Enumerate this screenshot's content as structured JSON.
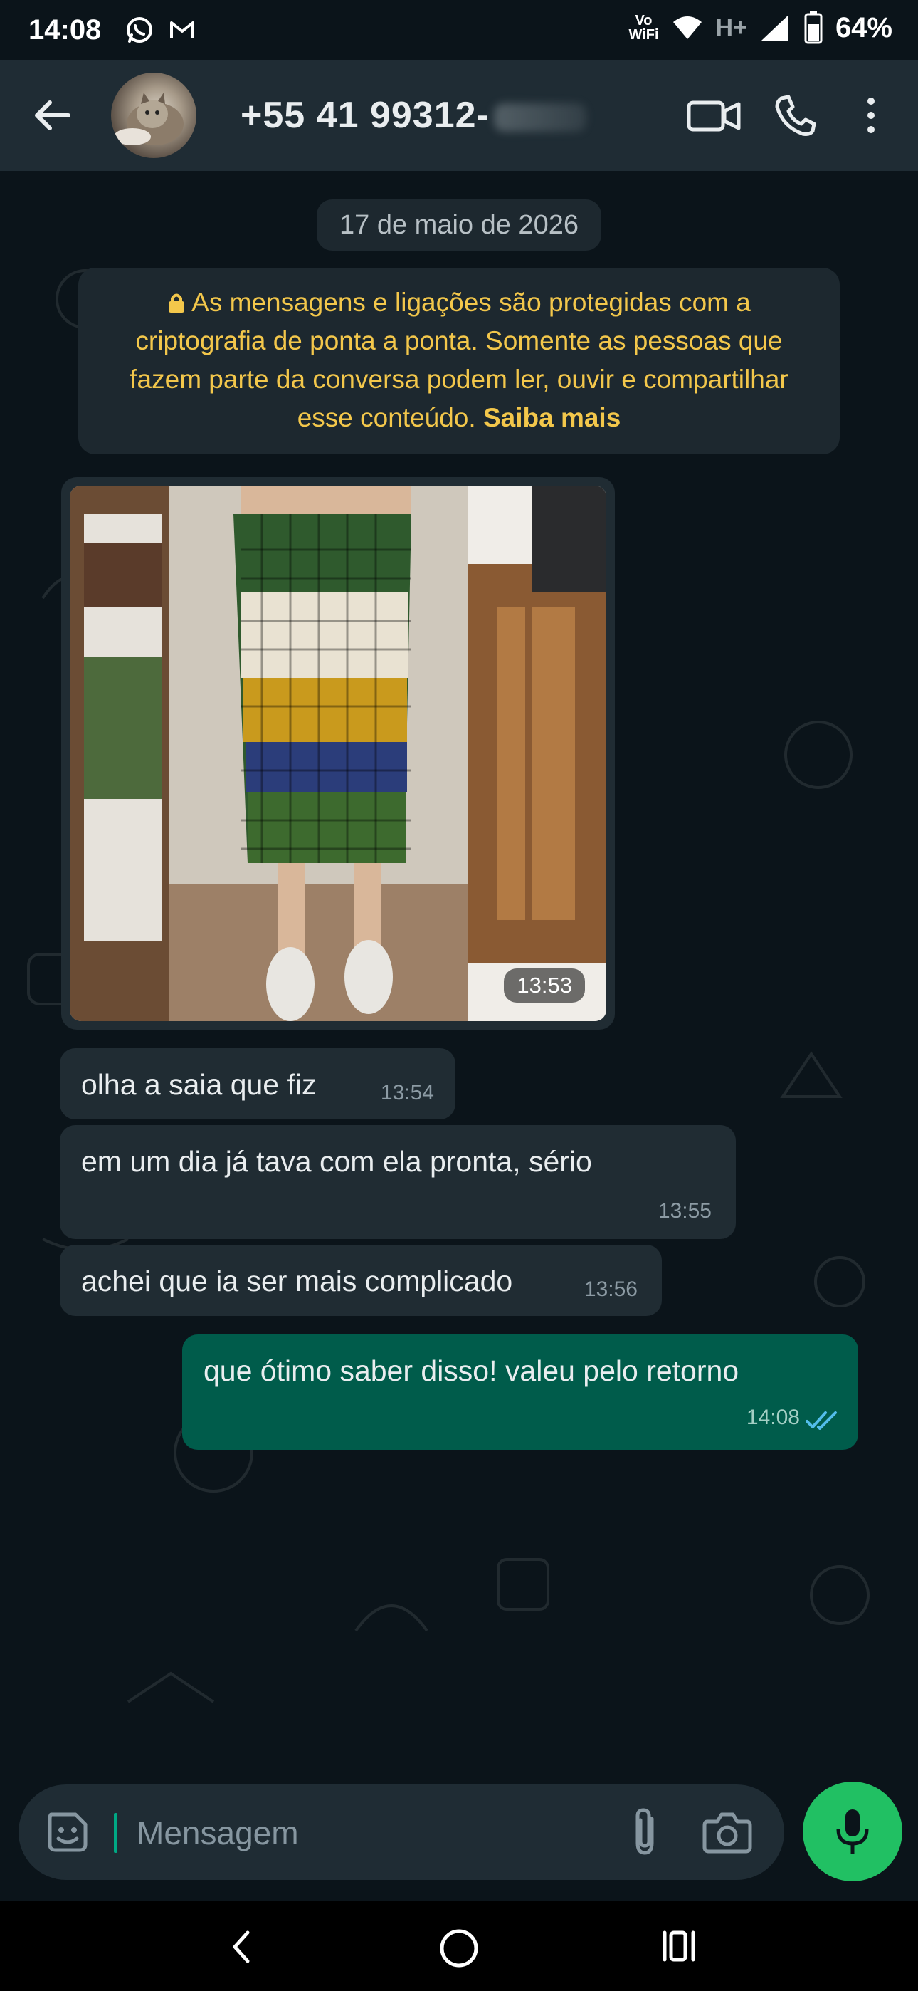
{
  "status_bar": {
    "time": "14:08",
    "volte_top": "Vo",
    "volte_bottom": "WiFi",
    "network": "H+",
    "battery": "64%",
    "app_icons": [
      "whatsapp-icon",
      "gmail-icon"
    ]
  },
  "header": {
    "contact_name": "+55 41 99312-",
    "icons": [
      "back-arrow-icon",
      "video-call-icon",
      "phone-icon",
      "more-vert-icon"
    ]
  },
  "chat": {
    "date_chip": "17 de maio de 2026",
    "e2e_notice": {
      "text": "As mensagens e ligações são protegidas com a criptografia de ponta a ponta. Somente as pessoas que fazem parte da conversa podem ler, ouvir e compartilhar esse conteúdo.",
      "link": "Saiba mais",
      "icon": "lock-icon"
    },
    "messages": [
      {
        "direction": "in",
        "type": "image",
        "time": "13:53"
      },
      {
        "direction": "in",
        "type": "text",
        "text": "olha a saia que fiz",
        "time": "13:54"
      },
      {
        "direction": "in",
        "type": "text",
        "text": "em um dia já tava com ela pronta, sério",
        "time": "13:55"
      },
      {
        "direction": "in",
        "type": "text",
        "text": "achei que ia ser mais complicado",
        "time": "13:56"
      },
      {
        "direction": "out",
        "type": "text",
        "text": "que ótimo saber disso! valeu pelo retorno",
        "time": "14:08",
        "status": "read"
      }
    ]
  },
  "input": {
    "placeholder": "Mensagem",
    "icons": [
      "sticker-icon",
      "attach-icon",
      "camera-icon",
      "mic-icon"
    ]
  },
  "colors": {
    "background": "#0b141a",
    "header": "#1f2c34",
    "bubble_in": "#202c33",
    "bubble_out": "#005c4b",
    "accent": "#00a884",
    "mic_button": "#21c063",
    "notice_text": "#f3c74b",
    "read_ticks": "#53bdeb"
  },
  "nav_bar": {
    "icons": [
      "nav-back-icon",
      "nav-home-icon",
      "nav-recent-icon"
    ]
  }
}
